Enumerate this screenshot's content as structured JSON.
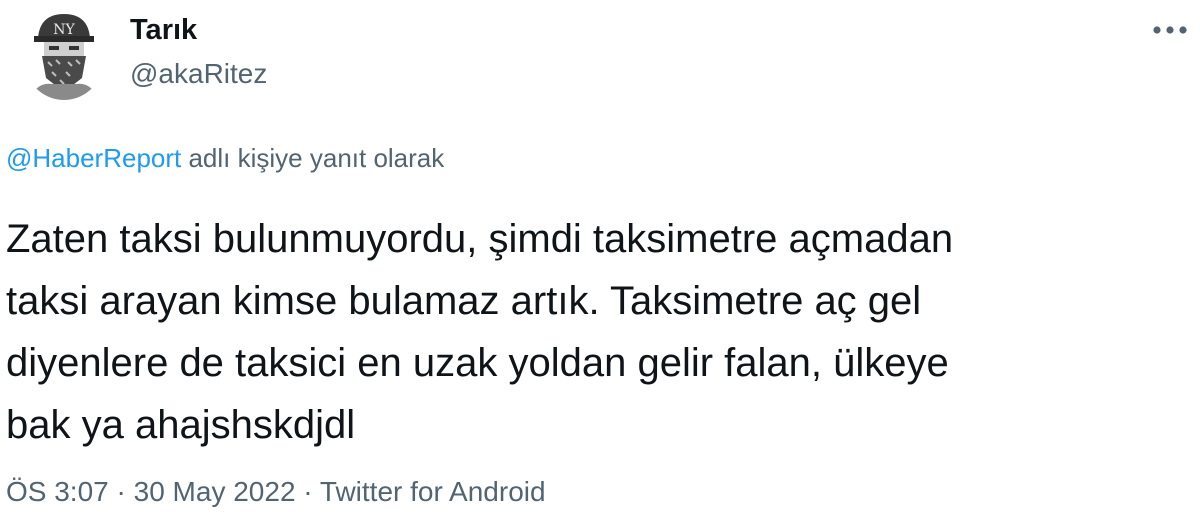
{
  "author": {
    "display_name": "Tarık",
    "handle": "@akaRitez",
    "avatar_icon": "masked-person-avatar-icon"
  },
  "more_icon": "more-horizontal-icon",
  "reply_context": {
    "mention": "@HaberReport",
    "suffix": " adlı kişiye yanıt olarak"
  },
  "tweet_text": "Zaten taksi bulunmuyordu, şimdi taksimetre açmadan\ntaksi arayan kimse bulamaz artık. Taksimetre aç gel\ndiyenlere de taksici en uzak yoldan gelir falan, ülkeye\nbak ya ahajshskdjdl",
  "meta": {
    "time": "ÖS 3:07",
    "separator": " · ",
    "date": "30 May 2022",
    "source": "Twitter for Android"
  },
  "colors": {
    "text": "#0f1419",
    "secondary": "#536471",
    "link": "#1d9bf0"
  }
}
